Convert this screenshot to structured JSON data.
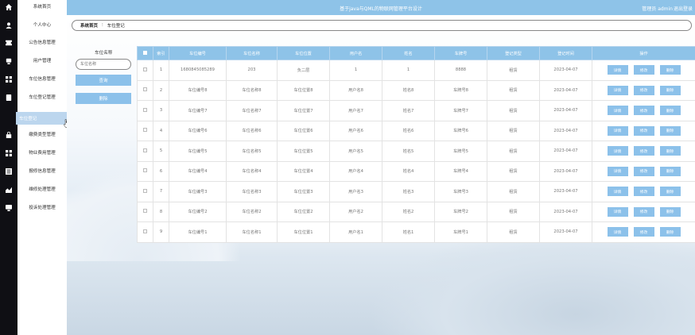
{
  "header": {
    "title": "基于java与QML的物联网管理平台设计",
    "user": "管理员 admin",
    "logout": "退出登录"
  },
  "sidebar": {
    "items": [
      {
        "label": "系统首页",
        "icon": "home-icon"
      },
      {
        "label": "个人中心",
        "icon": "user-icon"
      },
      {
        "label": "公告信息管理",
        "icon": "announcement-icon"
      },
      {
        "label": "用户管理",
        "icon": "users-icon"
      },
      {
        "label": "车位信息管理",
        "icon": "grid-icon"
      },
      {
        "label": "车位登记管理",
        "icon": "document-icon"
      },
      {
        "label": "车位登记",
        "icon": "none",
        "active": true
      },
      {
        "label": "缴费类型管理",
        "icon": "lock-icon"
      },
      {
        "label": "物业费用管理",
        "icon": "grid-icon"
      },
      {
        "label": "报修信息管理",
        "icon": "list-icon"
      },
      {
        "label": "维修处理管理",
        "icon": "chart-icon"
      },
      {
        "label": "投诉处理管理",
        "icon": "monitor-icon"
      }
    ]
  },
  "breadcrumb": {
    "home": "系统首页",
    "separator": "⁝",
    "current": "车位登记"
  },
  "search": {
    "label": "车位名称",
    "placeholder": "车位名称",
    "query_button": "查询",
    "delete_button": "删除"
  },
  "table": {
    "columns": [
      "索引",
      "车位编号",
      "车位名称",
      "车位位置",
      "用户名",
      "姓名",
      "车牌号",
      "登记类型",
      "登记时间",
      "操作"
    ],
    "rows": [
      {
        "index": "1",
        "code": "1680845085289",
        "name": "203",
        "location": "负二层",
        "username": "1",
        "realname": "1",
        "plate": "8888",
        "type": "租赁",
        "time": "2023-04-07"
      },
      {
        "index": "2",
        "code": "车位编号8",
        "name": "车位名称8",
        "location": "车位位置8",
        "username": "用户名8",
        "realname": "姓名8",
        "plate": "车牌号8",
        "type": "租赁",
        "time": "2023-04-07"
      },
      {
        "index": "3",
        "code": "车位编号7",
        "name": "车位名称7",
        "location": "车位位置7",
        "username": "用户名7",
        "realname": "姓名7",
        "plate": "车牌号7",
        "type": "租赁",
        "time": "2023-04-07"
      },
      {
        "index": "4",
        "code": "车位编号6",
        "name": "车位名称6",
        "location": "车位位置6",
        "username": "用户名6",
        "realname": "姓名6",
        "plate": "车牌号6",
        "type": "租赁",
        "time": "2023-04-07"
      },
      {
        "index": "5",
        "code": "车位编号5",
        "name": "车位名称5",
        "location": "车位位置5",
        "username": "用户名5",
        "realname": "姓名5",
        "plate": "车牌号5",
        "type": "租赁",
        "time": "2023-04-07"
      },
      {
        "index": "6",
        "code": "车位编号4",
        "name": "车位名称4",
        "location": "车位位置4",
        "username": "用户名4",
        "realname": "姓名4",
        "plate": "车牌号4",
        "type": "租赁",
        "time": "2023-04-07"
      },
      {
        "index": "7",
        "code": "车位编号3",
        "name": "车位名称3",
        "location": "车位位置3",
        "username": "用户名3",
        "realname": "姓名3",
        "plate": "车牌号3",
        "type": "租赁",
        "time": "2023-04-07"
      },
      {
        "index": "8",
        "code": "车位编号2",
        "name": "车位名称2",
        "location": "车位位置2",
        "username": "用户名2",
        "realname": "姓名2",
        "plate": "车牌号2",
        "type": "租赁",
        "time": "2023-04-07"
      },
      {
        "index": "9",
        "code": "车位编号1",
        "name": "车位名称1",
        "location": "车位位置1",
        "username": "用户名1",
        "realname": "姓名1",
        "plate": "车牌号1",
        "type": "租赁",
        "time": "2023-04-07"
      }
    ],
    "actions": {
      "detail": "详情",
      "edit": "修改",
      "delete": "删除"
    }
  },
  "colors": {
    "accent": "#8ec3e8",
    "button": "#8cc1ea",
    "rail": "#0f0f14",
    "active_menu": "#bcd6ee"
  }
}
